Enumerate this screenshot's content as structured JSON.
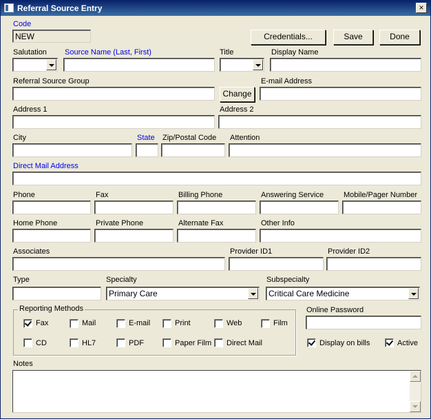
{
  "window": {
    "title": "Referral Source Entry",
    "close_glyph": "×"
  },
  "buttons": {
    "credentials": "Credentials...",
    "save": "Save",
    "done": "Done",
    "change": "Change"
  },
  "labels": {
    "code": "Code",
    "salutation": "Salutation",
    "source_name": "Source Name (Last, First)",
    "title": "Title",
    "display_name": "Display Name",
    "referral_source_group": "Referral Source Group",
    "email": "E-mail Address",
    "address1": "Address 1",
    "address2": "Address 2",
    "city": "City",
    "state": "State",
    "zip": "Zip/Postal Code",
    "attention": "Attention",
    "direct_mail": "Direct Mail Address",
    "phone": "Phone",
    "fax": "Fax",
    "billing_phone": "Billing Phone",
    "answering_service": "Answering Service",
    "mobile_pager": "Mobile/Pager Number",
    "home_phone": "Home Phone",
    "private_phone": "Private Phone",
    "alternate_fax": "Alternate Fax",
    "other_info": "Other Info",
    "associates": "Associates",
    "provider_id1": "Provider ID1",
    "provider_id2": "Provider ID2",
    "type": "Type",
    "specialty": "Specialty",
    "subspecialty": "Subspecialty",
    "online_password": "Online Password",
    "notes": "Notes"
  },
  "values": {
    "code": "NEW",
    "specialty": "Primary Care",
    "subspecialty": "Critical Care Medicine"
  },
  "reporting": {
    "legend": "Reporting Methods",
    "methods": [
      {
        "label": "Fax",
        "checked": true
      },
      {
        "label": "Mail",
        "checked": false
      },
      {
        "label": "E-mail",
        "checked": false
      },
      {
        "label": "Print",
        "checked": false
      },
      {
        "label": "Web",
        "checked": false
      },
      {
        "label": "Film",
        "checked": false
      },
      {
        "label": "CD",
        "checked": false
      },
      {
        "label": "HL7",
        "checked": false
      },
      {
        "label": "PDF",
        "checked": false
      },
      {
        "label": "Paper Film",
        "checked": false
      },
      {
        "label": "Direct Mail",
        "checked": false
      }
    ]
  },
  "options": {
    "display_on_bills": {
      "label": "Display on bills",
      "checked": true
    },
    "active": {
      "label": "Active",
      "checked": true
    }
  }
}
